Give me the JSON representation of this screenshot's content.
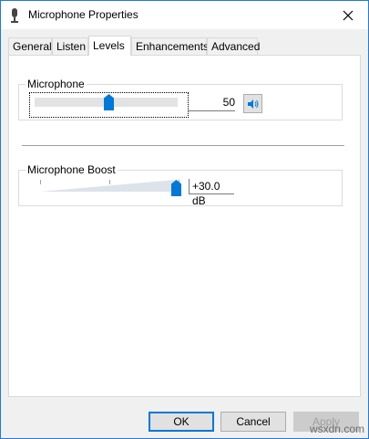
{
  "window": {
    "title": "Microphone Properties",
    "icon": "microphone-icon",
    "close_icon": "close-icon"
  },
  "tabs": [
    {
      "label": "General"
    },
    {
      "label": "Listen"
    },
    {
      "label": "Levels",
      "selected": true
    },
    {
      "label": "Enhancements"
    },
    {
      "label": "Advanced"
    }
  ],
  "levels": {
    "microphone": {
      "label": "Microphone",
      "value": "50",
      "level_fraction": 0.5,
      "mute_icon": "speaker-icon"
    },
    "boost": {
      "label": "Microphone Boost",
      "value": "+30.0 dB",
      "level_fraction": 1.0
    }
  },
  "buttons": {
    "ok": "OK",
    "cancel": "Cancel",
    "apply": "Apply"
  },
  "watermark": "wsxdn.com",
  "colors": {
    "accent": "#0078d7",
    "window_border": "#1f7ad8"
  }
}
